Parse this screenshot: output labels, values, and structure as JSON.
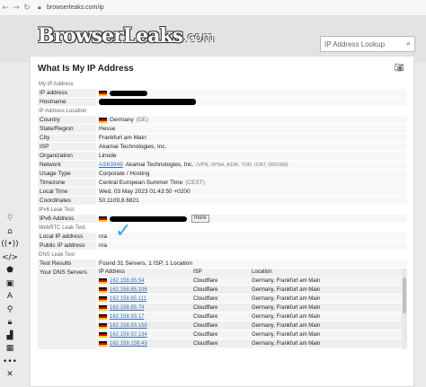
{
  "browser": {
    "url": "browserleaks.com/ip"
  },
  "header": {
    "logo_text": "BrowserLeaks",
    "logo_domain": ".com",
    "search_placeholder": "IP Address Lookup"
  },
  "page": {
    "title": "What Is My IP Address"
  },
  "sections": {
    "my_ip": "My IP Address",
    "location": "IP Address Location",
    "ipv6": "IPv6 Leak Test",
    "webrtc": "WebRTC Leak Test",
    "dns": "DNS Leak Test"
  },
  "my_ip": {
    "ip_label": "IP address",
    "hostname_label": "Hostname"
  },
  "location": {
    "country_label": "Country",
    "country": "Germany",
    "country_code": "(DE)",
    "state_label": "State/Region",
    "state": "Hesse",
    "city_label": "City",
    "city": "Frankfurt am Main",
    "isp_label": "ISP",
    "isp": "Akamai Technologies, Inc.",
    "org_label": "Organization",
    "org": "Linode",
    "network_label": "Network",
    "asn": "AS63949",
    "network": "Akamai Technologies, Inc.",
    "network_tags": "(VPN, VPSH, A10K, TOR, ICRT, DDOSM)",
    "usage_label": "Usage Type",
    "usage": "Corporate / Hosting",
    "tz_label": "Timezone",
    "tz": "Central European Summer Time",
    "tz_abbr": "(CEST)",
    "time_label": "Local Time",
    "time": "Wed, 03 May 2023 01:43:50 +0200",
    "coord_label": "Coordinates",
    "coord": "50.1109,8.6821"
  },
  "ipv6": {
    "label": "IPv6 Address",
    "more": "more"
  },
  "webrtc": {
    "local_label": "Local IP address",
    "local": "n/a",
    "public_label": "Public IP address",
    "public": "n/a"
  },
  "dns": {
    "results_label": "Test Results",
    "results": "Found 31 Servers, 1 ISP, 1 Location",
    "servers_label": "Your DNS Servers",
    "col_ip": "IP Address",
    "col_isp": "ISP",
    "col_loc": "Location",
    "rows": [
      {
        "ip": "162.158.85.54",
        "isp": "Cloudflare",
        "loc": "Germany, Frankfurt am Main"
      },
      {
        "ip": "162.158.85.106",
        "isp": "Cloudflare",
        "loc": "Germany, Frankfurt am Main"
      },
      {
        "ip": "162.158.85.111",
        "isp": "Cloudflare",
        "loc": "Germany, Frankfurt am Main"
      },
      {
        "ip": "162.158.85.74",
        "isp": "Cloudflare",
        "loc": "Germany, Frankfurt am Main"
      },
      {
        "ip": "162.158.93.17",
        "isp": "Cloudflare",
        "loc": "Germany, Frankfurt am Main"
      },
      {
        "ip": "162.158.93.158",
        "isp": "Cloudflare",
        "loc": "Germany, Frankfurt am Main"
      },
      {
        "ip": "162.158.92.134",
        "isp": "Cloudflare",
        "loc": "Germany, Frankfurt am Main"
      },
      {
        "ip": "162.158.159.43",
        "isp": "Cloudflare",
        "loc": "Germany, Frankfurt am Main"
      }
    ]
  },
  "colors": {
    "link": "#3a6fb5",
    "check": "#2aa8d8",
    "redaction": "#000000"
  }
}
